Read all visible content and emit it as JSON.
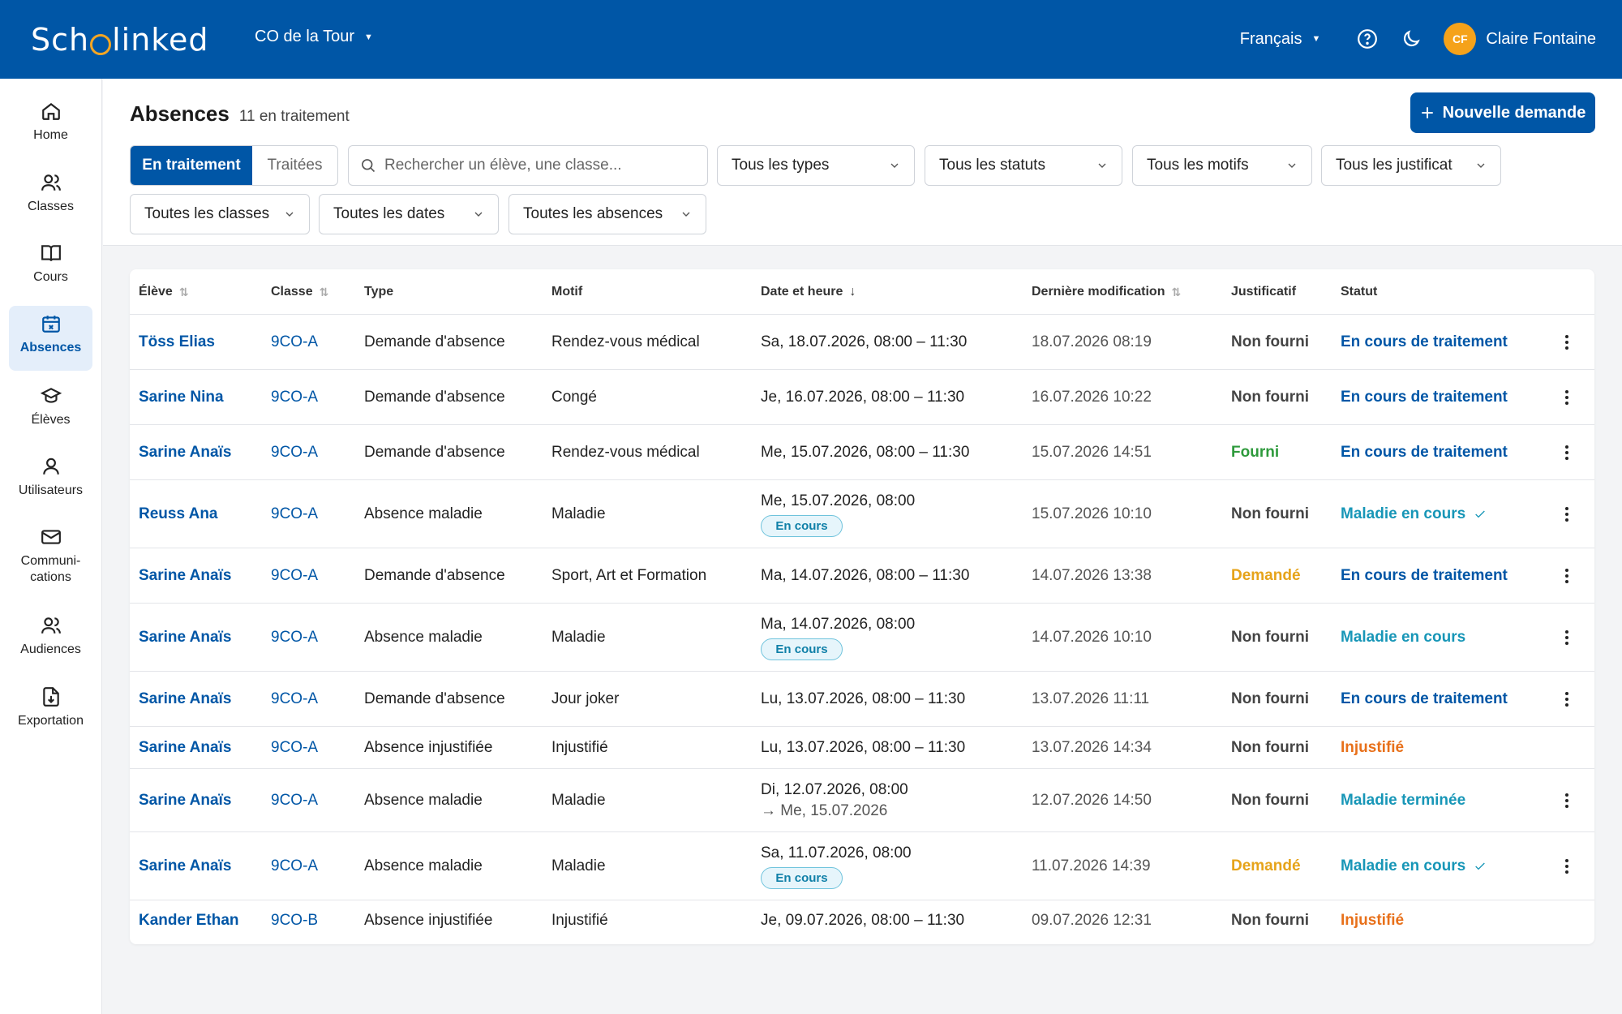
{
  "app": {
    "logo_text_left": "Sch",
    "logo_text_right": "linked",
    "school": "CO de la Tour",
    "language": "Français",
    "user_initials": "CF",
    "user_name": "Claire Fontaine"
  },
  "sidebar": {
    "items": [
      {
        "label": "Home",
        "icon": "home-icon"
      },
      {
        "label": "Classes",
        "icon": "users-icon"
      },
      {
        "label": "Cours",
        "icon": "book-icon"
      },
      {
        "label": "Absences",
        "icon": "calendar-x-icon",
        "active": true
      },
      {
        "label": "Élèves",
        "icon": "graduation-cap-icon"
      },
      {
        "label": "Utilisateurs",
        "icon": "user-icon"
      },
      {
        "label": "Communi-",
        "label2": "cations",
        "icon": "mail-icon"
      },
      {
        "label": "Audiences",
        "icon": "audience-icon"
      },
      {
        "label": "Exportation",
        "icon": "export-icon"
      }
    ]
  },
  "header": {
    "title": "Absences",
    "count": "11 en traitement",
    "new_button": "Nouvelle demande",
    "tab_active": "En traitement",
    "tab_inactive": "Traitées",
    "search_placeholder": "Rechercher un élève, une classe...",
    "filters": {
      "types": "Tous les types",
      "statuts": "Tous les statuts",
      "motifs": "Tous les motifs",
      "justificatifs": "Tous les justificat",
      "classes": "Toutes les classes",
      "dates": "Toutes les dates",
      "absences": "Toutes les absences"
    }
  },
  "table": {
    "columns": {
      "eleve": "Élève",
      "classe": "Classe",
      "type": "Type",
      "motif": "Motif",
      "date": "Date et heure",
      "modification": "Dernière modification",
      "justificatif": "Justificatif",
      "statut": "Statut"
    },
    "rows": [
      {
        "eleve": "Töss Elias",
        "classe": "9CO-A",
        "type": "Demande d'absence",
        "motif": "Rendez-vous médical",
        "date": "Sa, 18.07.2026, 08:00 – 11:30",
        "modif": "18.07.2026 08:19",
        "just": "Non fourni",
        "statut": "En cours de traitement"
      },
      {
        "eleve": "Sarine Nina",
        "classe": "9CO-A",
        "type": "Demande d'absence",
        "motif": "Congé",
        "date": "Je, 16.07.2026, 08:00 – 11:30",
        "modif": "16.07.2026 10:22",
        "just": "Non fourni",
        "statut": "En cours de traitement"
      },
      {
        "eleve": "Sarine Anaïs",
        "classe": "9CO-A",
        "type": "Demande d'absence",
        "motif": "Rendez-vous médical",
        "date": "Me, 15.07.2026, 08:00 – 11:30",
        "modif": "15.07.2026 14:51",
        "just": "Fourni",
        "statut": "En cours de traitement"
      },
      {
        "eleve": "Reuss Ana",
        "classe": "9CO-A",
        "type": "Absence maladie",
        "motif": "Maladie",
        "date": "Me, 15.07.2026, 08:00",
        "pill": "En cours",
        "modif": "15.07.2026 10:10",
        "just": "Non fourni",
        "statut": "Maladie en cours"
      },
      {
        "eleve": "Sarine Anaïs",
        "classe": "9CO-A",
        "type": "Demande d'absence",
        "motif": "Sport, Art et Formation",
        "date": "Ma, 14.07.2026, 08:00 – 11:30",
        "modif": "14.07.2026 13:38",
        "just": "Demandé",
        "statut": "En cours de traitement"
      },
      {
        "eleve": "Sarine Anaïs",
        "classe": "9CO-A",
        "type": "Absence maladie",
        "motif": "Maladie",
        "date": "Ma, 14.07.2026, 08:00",
        "pill": "En cours",
        "modif": "14.07.2026 10:10",
        "just": "Non fourni",
        "statut": "Maladie en cours"
      },
      {
        "eleve": "Sarine Anaïs",
        "classe": "9CO-A",
        "type": "Demande d'absence",
        "motif": "Jour joker",
        "date": "Lu, 13.07.2026, 08:00 – 11:30",
        "modif": "13.07.2026 11:11",
        "just": "Non fourni",
        "statut": "En cours de traitement"
      },
      {
        "eleve": "Sarine Anaïs",
        "classe": "9CO-A",
        "type": "Absence injustifiée",
        "motif": "Injustifié",
        "date": "Lu, 13.07.2026, 08:00 – 11:30",
        "modif": "13.07.2026 14:34",
        "just": "Non fourni",
        "statut": "Injustifié"
      },
      {
        "eleve": "Sarine Anaïs",
        "classe": "9CO-A",
        "type": "Absence maladie",
        "motif": "Maladie",
        "date": "Di, 12.07.2026, 08:00",
        "date2": "→ Me, 15.07.2026",
        "modif": "12.07.2026 14:50",
        "just": "Non fourni",
        "statut": "Maladie terminée"
      },
      {
        "eleve": "Sarine Anaïs",
        "classe": "9CO-A",
        "type": "Absence maladie",
        "motif": "Maladie",
        "date": "Sa, 11.07.2026, 08:00",
        "pill": "En cours",
        "modif": "11.07.2026 14:39",
        "just": "Demandé",
        "statut": "Maladie en cours"
      },
      {
        "eleve": "Kander Ethan",
        "classe": "9CO-B",
        "type": "Absence injustifiée",
        "motif": "Injustifié",
        "date": "Je, 09.07.2026, 08:00 – 11:30",
        "modif": "09.07.2026 12:31",
        "just": "Non fourni",
        "statut": "Injustifié"
      }
    ]
  },
  "colors": {
    "brand": "#0056a6",
    "status_teal": "#1796b7",
    "status_orange": "#e8701a",
    "just_green": "#2e9a3c",
    "just_yellow": "#e6a31a"
  }
}
